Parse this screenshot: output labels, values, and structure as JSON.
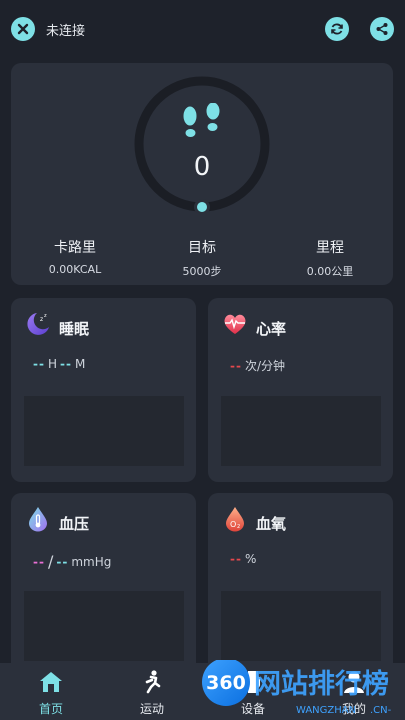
{
  "header": {
    "status": "未连接"
  },
  "steps": {
    "value": "0",
    "stats": [
      {
        "label": "卡路里",
        "value": "0.00KCAL"
      },
      {
        "label": "目标",
        "value": "5000步"
      },
      {
        "label": "里程",
        "value": "0.00公里"
      }
    ]
  },
  "cards": {
    "sleep": {
      "title": "睡眠",
      "h_dash": "--",
      "h_unit": "H",
      "m_dash": "--",
      "m_unit": "M"
    },
    "heart": {
      "title": "心率",
      "dash": "--",
      "unit": "次/分钟"
    },
    "pressure": {
      "title": "血压",
      "sys_dash": "--",
      "sep": "/",
      "dia_dash": "--",
      "unit": "mmHg"
    },
    "oxygen": {
      "title": "血氧",
      "dash": "--",
      "unit": "%"
    }
  },
  "nav": {
    "items": [
      {
        "label": "首页",
        "active": true
      },
      {
        "label": "运动",
        "active": false
      },
      {
        "label": "设备",
        "active": false
      },
      {
        "label": "我的",
        "active": false
      }
    ]
  },
  "watermark": {
    "brand_num": "360",
    "brand_text": "网站排行榜",
    "sub": "WANGZHAN",
    "domain": ".CN-"
  },
  "colors": {
    "accent": "#7ee0e6",
    "sleep_dash": "#7ee0e6",
    "heart_dash": "#e5484d",
    "pressure_sys": "#ea6fd6",
    "pressure_dia": "#7ee0e6",
    "oxygen_dash": "#e5484d"
  }
}
